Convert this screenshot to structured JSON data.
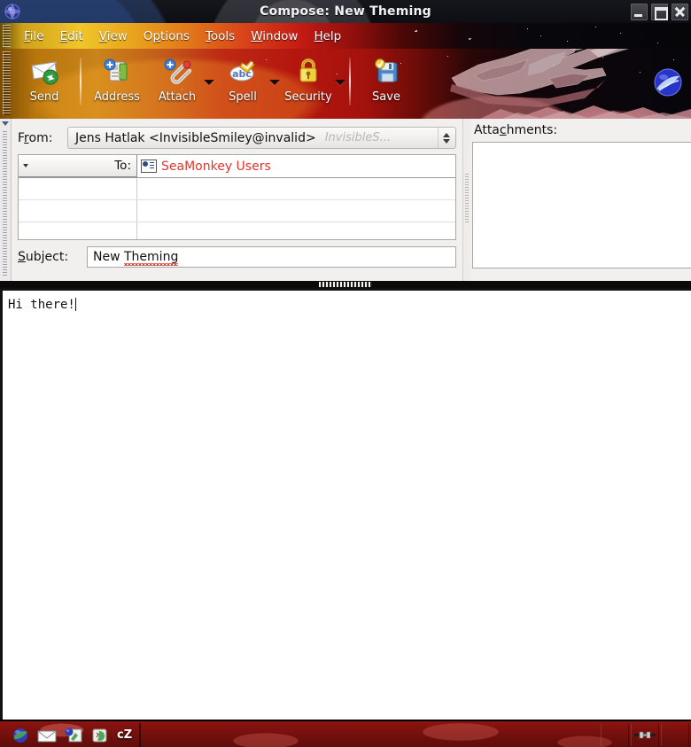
{
  "window": {
    "title": "Compose: New Theming",
    "app_icon": "seamonkey-globe-icon",
    "controls": {
      "minimize": "Minimize",
      "maximize": "Maximize",
      "close": "Close"
    }
  },
  "menubar": {
    "items": [
      {
        "label": "File",
        "accesskey": "F"
      },
      {
        "label": "Edit",
        "accesskey": "E"
      },
      {
        "label": "View",
        "accesskey": "V"
      },
      {
        "label": "Options",
        "accesskey": "p"
      },
      {
        "label": "Tools",
        "accesskey": "T"
      },
      {
        "label": "Window",
        "accesskey": "W"
      },
      {
        "label": "Help",
        "accesskey": "H"
      }
    ]
  },
  "toolbar": {
    "buttons": [
      {
        "label": "Send",
        "icon": "send-envelope-icon",
        "has_dropdown": false
      },
      {
        "label": "Address",
        "icon": "address-book-icon",
        "has_dropdown": false
      },
      {
        "label": "Attach",
        "icon": "paperclip-icon",
        "has_dropdown": true
      },
      {
        "label": "Spell",
        "icon": "spell-abc-icon",
        "has_dropdown": true
      },
      {
        "label": "Security",
        "icon": "padlock-icon",
        "has_dropdown": true
      },
      {
        "label": "Save",
        "icon": "floppy-save-icon",
        "has_dropdown": false
      }
    ],
    "throbber": "seamonkey-throbber-icon"
  },
  "compose": {
    "from": {
      "label": "From:",
      "accesskey": "r",
      "value": "Jens Hatlak <InvisibleSmiley@invalid>",
      "ghost": "InvisibleS...",
      "spinner": "identity-spinner"
    },
    "recipients": {
      "rows": [
        {
          "type": "To:",
          "value": "SeaMonkey Users",
          "icon": "contact-card-icon"
        },
        {
          "type": "",
          "value": ""
        },
        {
          "type": "",
          "value": ""
        },
        {
          "type": "",
          "value": ""
        }
      ]
    },
    "subject": {
      "label": "Subject:",
      "accesskey": "S",
      "value_plain": "New ",
      "value_misspelled": "Theming",
      "full_value": "New Theming"
    },
    "attachments": {
      "label": "Attachments:",
      "accesskey": "c",
      "items": []
    },
    "body": {
      "text": "Hi there!"
    }
  },
  "taskbar": {
    "launchers": [
      {
        "icon": "globe-blue-icon",
        "label": ""
      },
      {
        "icon": "mail-envelope-icon",
        "label": ""
      },
      {
        "icon": "composer-icon",
        "label": ""
      },
      {
        "icon": "chatzilla-icon",
        "label": ""
      }
    ],
    "task_label": "cZ",
    "tray": [
      {
        "icon": "network-plug-icon"
      }
    ]
  },
  "colors": {
    "accent_red": "#e2352c",
    "menubar_gold": "#f0c62a",
    "menubar_red": "#c31a12",
    "taskbar_red": "#8c1410",
    "spell_underline": "#d43a33"
  }
}
